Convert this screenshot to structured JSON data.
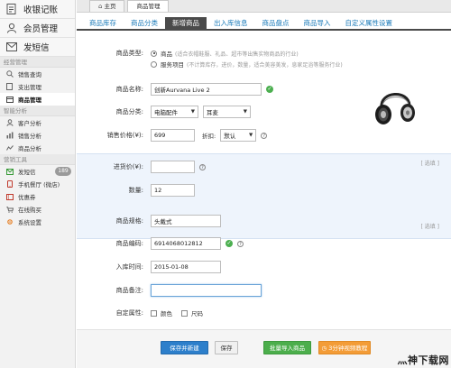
{
  "sidebar": {
    "top_items": [
      {
        "label": "收银记账",
        "icon": "document-icon"
      },
      {
        "label": "会员管理",
        "icon": "user-icon"
      },
      {
        "label": "发短信",
        "icon": "envelope-icon"
      }
    ],
    "sections": [
      {
        "title": "经营管理",
        "items": [
          {
            "label": "销售查询",
            "icon": "search-icon"
          },
          {
            "label": "支出管理",
            "icon": "file-icon"
          },
          {
            "label": "商品管理",
            "icon": "box-icon",
            "active": true
          }
        ]
      },
      {
        "title": "智能分析",
        "items": [
          {
            "label": "客户分析",
            "icon": "user-small-icon"
          },
          {
            "label": "销售分析",
            "icon": "bar-chart-icon"
          },
          {
            "label": "商品分析",
            "icon": "line-chart-icon"
          }
        ]
      },
      {
        "title": "营销工具",
        "items": [
          {
            "label": "发短信",
            "icon": "sms-icon",
            "badge": "189"
          },
          {
            "label": "手机餐厅 (微店)",
            "icon": "phone-icon"
          },
          {
            "label": "优惠券",
            "icon": "coupon-icon"
          },
          {
            "label": "在线购买",
            "icon": "cart-icon"
          },
          {
            "label": "系统设置",
            "icon": "gear-icon"
          }
        ]
      }
    ]
  },
  "topbar": {
    "tabs": [
      {
        "label": "主页",
        "icon": "home-icon"
      },
      {
        "label": "商品管理",
        "active": true
      }
    ]
  },
  "subtabs": [
    {
      "label": "商品库存"
    },
    {
      "label": "商品分类"
    },
    {
      "label": "新增商品",
      "active": true
    },
    {
      "label": "出入库信息"
    },
    {
      "label": "商品盘点"
    },
    {
      "label": "商品导入"
    },
    {
      "label": "自定义属性设置"
    }
  ],
  "form": {
    "type": {
      "label": "商品类型:",
      "options": [
        {
          "name": "商品",
          "hint": "(适合衣帽鞋服、礼品、超市等出售实物商品的行业)",
          "selected": true
        },
        {
          "name": "服务项目",
          "hint": "(不计算库存，进价，数量，适合美容美发，息家足浴等服务行业)",
          "selected": false
        }
      ]
    },
    "name": {
      "label": "商品名称:",
      "value": "创新Aurvana Live 2"
    },
    "category": {
      "label": "商品分类:",
      "value1": "电脑配件",
      "value2": "耳麦"
    },
    "price": {
      "label": "销售价格(¥):",
      "value": "699",
      "discount_label": "折扣:",
      "discount_value": "默认"
    },
    "cost": {
      "label": "进货价(¥):",
      "value": "",
      "optional": "[ 选填 ]"
    },
    "qty": {
      "label": "数量:",
      "value": "12"
    },
    "spec": {
      "label": "商品规格:",
      "value": "头戴式",
      "optional": "[ 选填 ]"
    },
    "code": {
      "label": "商品编码:",
      "value": "6914068012812"
    },
    "date": {
      "label": "入库时间:",
      "value": "2015-01-08"
    },
    "note": {
      "label": "商品备注:",
      "value": ""
    },
    "attrs": {
      "label": "自定属性:",
      "color": "颜色",
      "size": "尺码"
    }
  },
  "buttons": {
    "save_new": "保存并新建",
    "save": "保存",
    "batch_import": "批量导入商品",
    "video": "3分钟视频教程"
  },
  "colors": {
    "accent_blue": "#2d7fcb",
    "green": "#4cae4c",
    "orange": "#f39c37",
    "link": "#1a7ab8"
  },
  "watermark": "灬神下载网"
}
